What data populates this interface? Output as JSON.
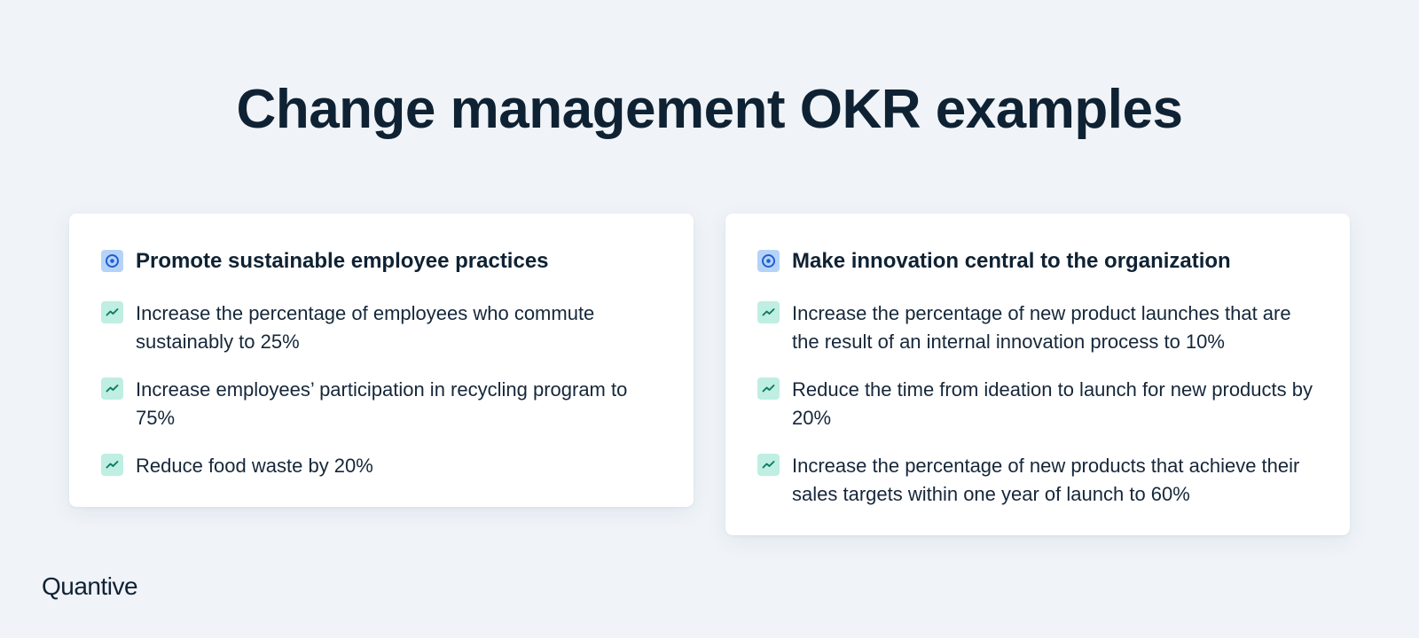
{
  "title": "Change management OKR examples",
  "cards": [
    {
      "objective": "Promote sustainable employee practices",
      "key_results": [
        "Increase the percentage of employees who commute sustainably to 25%",
        "Increase employees’ participation in recycling program to 75%",
        "Reduce food waste by 20%"
      ]
    },
    {
      "objective": "Make innovation central to the organization",
      "key_results": [
        "Increase the percentage of new product launches that are the result of an internal innovation process to 10%",
        "Reduce the time from ideation to launch for new products by 20%",
        "Increase the percentage of new products that achieve their sales targets within one year of launch to 60%"
      ]
    }
  ],
  "logo": "Quantive",
  "icons": {
    "objective": "target-icon",
    "key_result": "trend-line-icon"
  },
  "colors": {
    "objective_icon_bg": "#b6d3f7",
    "objective_icon_fg": "#1f5fd1",
    "key_result_icon_bg": "#bfeee2",
    "key_result_icon_fg": "#0e7a62"
  }
}
